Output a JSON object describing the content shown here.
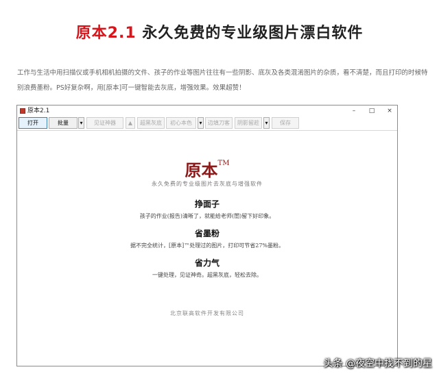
{
  "headline": {
    "brand": "原本2.1",
    "rest": "永久免费的专业级图片漂白软件"
  },
  "description": "工作与生活中用扫描仪或手机相机拍摄的文件、孩子的作业等图片往往有一些阴影、底灰及各类混淆图片的杂质，看不清楚，而且打印的时候特别浪费墨粉。PS好复杂啊，用[原本]可一键智能去灰底，增强效果。效果超赞！",
  "window": {
    "title": "原本2.1",
    "controls": {
      "minimize": "–",
      "maximize": "□",
      "close": "×"
    },
    "toolbar": {
      "open": "打开",
      "batch": "批量",
      "dropdown1": "▾",
      "cert_photo": "见证神器",
      "up": "▲",
      "super_black": "超黑灰底",
      "original_color": "初心本色",
      "dropdown2": "▾",
      "edge_trim": "边填刀客",
      "shadow_remove": "阴影留趁",
      "dropdown3": "▾",
      "save": "保存"
    },
    "content": {
      "logo": "原本",
      "trademark": "TM",
      "tagline": "永久免费的专业级图片去灰底与增强软件",
      "sections": [
        {
          "heading": "挣面子",
          "text": "孩子的作业(报告)清晰了，就能给老师(閨)留下好印象。"
        },
        {
          "heading": "省墨粉",
          "text": "据不完全统计，[原本]™处理过的图片，打印可节省27%墨粉。"
        },
        {
          "heading": "省力气",
          "text": "一键处理，见证神奇。超黑灰底，轻松去除。"
        }
      ],
      "company": "北京联高软件开发有限公司"
    }
  },
  "watermark": "头条 @夜空中找不到的星"
}
